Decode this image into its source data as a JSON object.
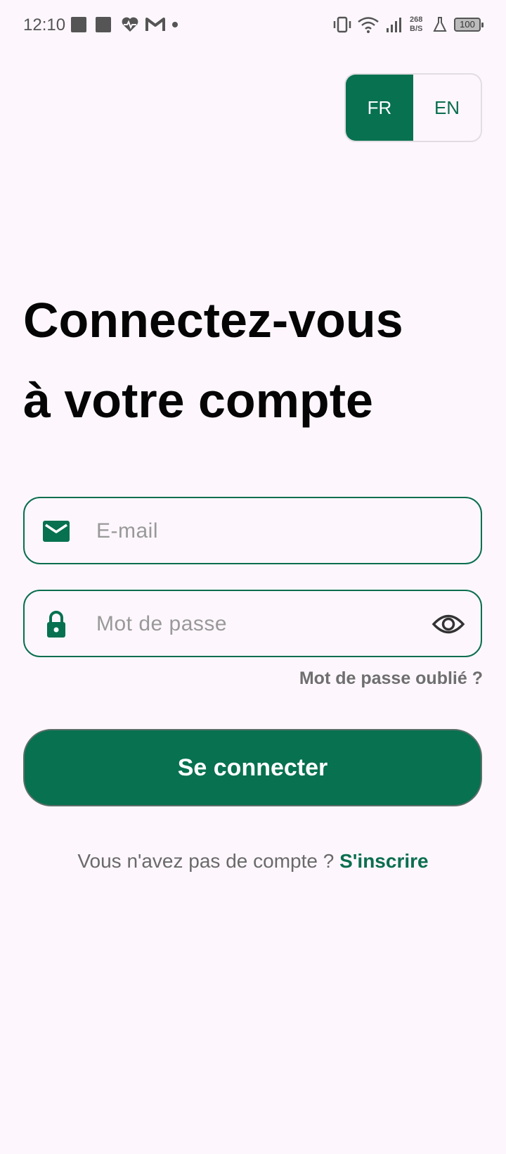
{
  "status_bar": {
    "time": "12:10",
    "net_speed_value": "268",
    "net_speed_unit": "B/S",
    "battery": "100"
  },
  "language_toggle": {
    "options": [
      "FR",
      "EN"
    ],
    "selected": "FR"
  },
  "title": {
    "line1": "Connectez-vous",
    "line2": "à votre compte"
  },
  "form": {
    "email": {
      "placeholder": "E-mail",
      "value": "",
      "icon": "envelope-icon"
    },
    "password": {
      "placeholder": "Mot de passe",
      "value": "",
      "icon": "lock-icon",
      "toggle_icon": "eye-icon"
    },
    "forgot_label": "Mot de passe oublié ?",
    "submit_label": "Se connecter"
  },
  "signup": {
    "prompt": "Vous n'avez pas de compte ?",
    "link_label": "S'inscrire"
  },
  "colors": {
    "primary": "#077150",
    "background": "#fdf7fd",
    "text": "#050505",
    "muted": "#6f6f6f"
  }
}
